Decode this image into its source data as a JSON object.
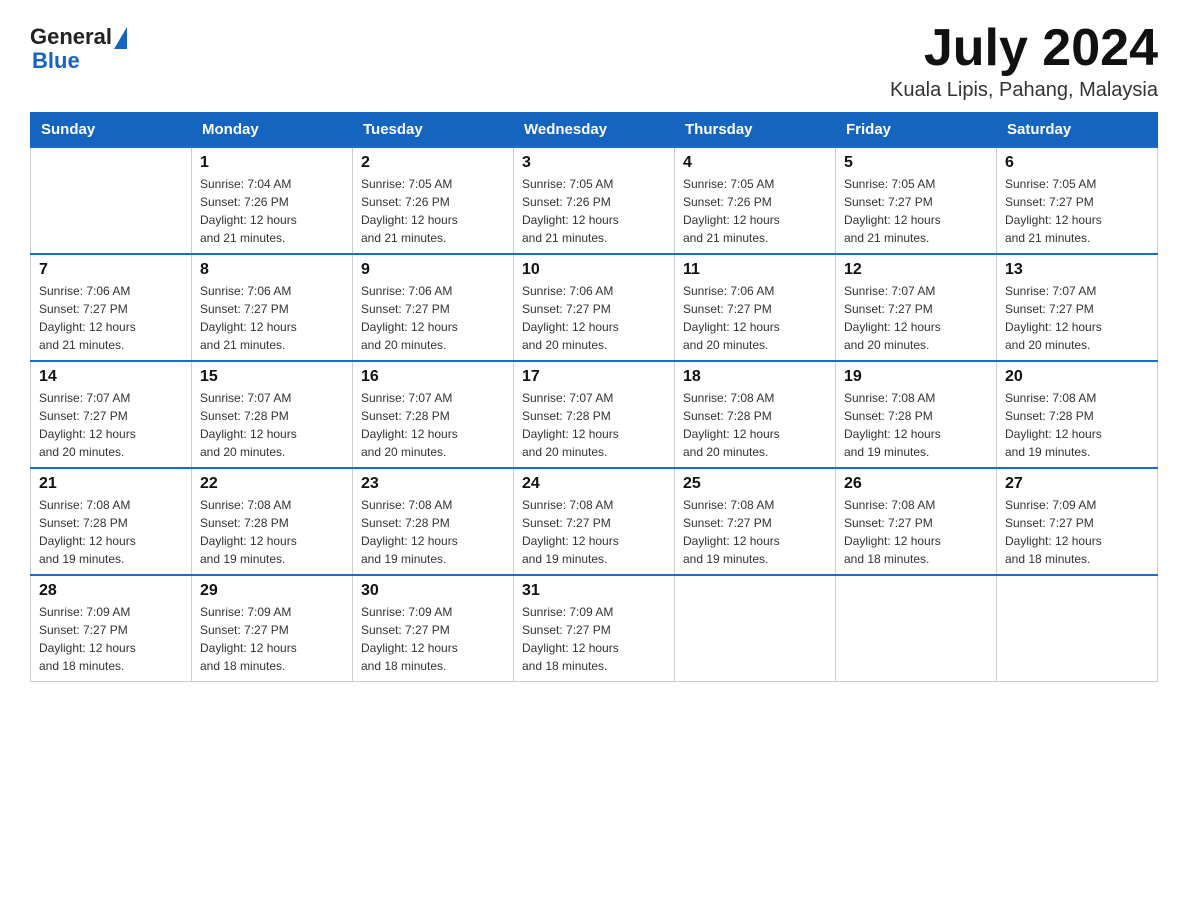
{
  "header": {
    "logo_text_general": "General",
    "logo_text_blue": "Blue",
    "title": "July 2024",
    "subtitle": "Kuala Lipis, Pahang, Malaysia"
  },
  "calendar": {
    "days_of_week": [
      "Sunday",
      "Monday",
      "Tuesday",
      "Wednesday",
      "Thursday",
      "Friday",
      "Saturday"
    ],
    "weeks": [
      [
        {
          "day": "",
          "info": ""
        },
        {
          "day": "1",
          "info": "Sunrise: 7:04 AM\nSunset: 7:26 PM\nDaylight: 12 hours\nand 21 minutes."
        },
        {
          "day": "2",
          "info": "Sunrise: 7:05 AM\nSunset: 7:26 PM\nDaylight: 12 hours\nand 21 minutes."
        },
        {
          "day": "3",
          "info": "Sunrise: 7:05 AM\nSunset: 7:26 PM\nDaylight: 12 hours\nand 21 minutes."
        },
        {
          "day": "4",
          "info": "Sunrise: 7:05 AM\nSunset: 7:26 PM\nDaylight: 12 hours\nand 21 minutes."
        },
        {
          "day": "5",
          "info": "Sunrise: 7:05 AM\nSunset: 7:27 PM\nDaylight: 12 hours\nand 21 minutes."
        },
        {
          "day": "6",
          "info": "Sunrise: 7:05 AM\nSunset: 7:27 PM\nDaylight: 12 hours\nand 21 minutes."
        }
      ],
      [
        {
          "day": "7",
          "info": "Sunrise: 7:06 AM\nSunset: 7:27 PM\nDaylight: 12 hours\nand 21 minutes."
        },
        {
          "day": "8",
          "info": "Sunrise: 7:06 AM\nSunset: 7:27 PM\nDaylight: 12 hours\nand 21 minutes."
        },
        {
          "day": "9",
          "info": "Sunrise: 7:06 AM\nSunset: 7:27 PM\nDaylight: 12 hours\nand 20 minutes."
        },
        {
          "day": "10",
          "info": "Sunrise: 7:06 AM\nSunset: 7:27 PM\nDaylight: 12 hours\nand 20 minutes."
        },
        {
          "day": "11",
          "info": "Sunrise: 7:06 AM\nSunset: 7:27 PM\nDaylight: 12 hours\nand 20 minutes."
        },
        {
          "day": "12",
          "info": "Sunrise: 7:07 AM\nSunset: 7:27 PM\nDaylight: 12 hours\nand 20 minutes."
        },
        {
          "day": "13",
          "info": "Sunrise: 7:07 AM\nSunset: 7:27 PM\nDaylight: 12 hours\nand 20 minutes."
        }
      ],
      [
        {
          "day": "14",
          "info": "Sunrise: 7:07 AM\nSunset: 7:27 PM\nDaylight: 12 hours\nand 20 minutes."
        },
        {
          "day": "15",
          "info": "Sunrise: 7:07 AM\nSunset: 7:28 PM\nDaylight: 12 hours\nand 20 minutes."
        },
        {
          "day": "16",
          "info": "Sunrise: 7:07 AM\nSunset: 7:28 PM\nDaylight: 12 hours\nand 20 minutes."
        },
        {
          "day": "17",
          "info": "Sunrise: 7:07 AM\nSunset: 7:28 PM\nDaylight: 12 hours\nand 20 minutes."
        },
        {
          "day": "18",
          "info": "Sunrise: 7:08 AM\nSunset: 7:28 PM\nDaylight: 12 hours\nand 20 minutes."
        },
        {
          "day": "19",
          "info": "Sunrise: 7:08 AM\nSunset: 7:28 PM\nDaylight: 12 hours\nand 19 minutes."
        },
        {
          "day": "20",
          "info": "Sunrise: 7:08 AM\nSunset: 7:28 PM\nDaylight: 12 hours\nand 19 minutes."
        }
      ],
      [
        {
          "day": "21",
          "info": "Sunrise: 7:08 AM\nSunset: 7:28 PM\nDaylight: 12 hours\nand 19 minutes."
        },
        {
          "day": "22",
          "info": "Sunrise: 7:08 AM\nSunset: 7:28 PM\nDaylight: 12 hours\nand 19 minutes."
        },
        {
          "day": "23",
          "info": "Sunrise: 7:08 AM\nSunset: 7:28 PM\nDaylight: 12 hours\nand 19 minutes."
        },
        {
          "day": "24",
          "info": "Sunrise: 7:08 AM\nSunset: 7:27 PM\nDaylight: 12 hours\nand 19 minutes."
        },
        {
          "day": "25",
          "info": "Sunrise: 7:08 AM\nSunset: 7:27 PM\nDaylight: 12 hours\nand 19 minutes."
        },
        {
          "day": "26",
          "info": "Sunrise: 7:08 AM\nSunset: 7:27 PM\nDaylight: 12 hours\nand 18 minutes."
        },
        {
          "day": "27",
          "info": "Sunrise: 7:09 AM\nSunset: 7:27 PM\nDaylight: 12 hours\nand 18 minutes."
        }
      ],
      [
        {
          "day": "28",
          "info": "Sunrise: 7:09 AM\nSunset: 7:27 PM\nDaylight: 12 hours\nand 18 minutes."
        },
        {
          "day": "29",
          "info": "Sunrise: 7:09 AM\nSunset: 7:27 PM\nDaylight: 12 hours\nand 18 minutes."
        },
        {
          "day": "30",
          "info": "Sunrise: 7:09 AM\nSunset: 7:27 PM\nDaylight: 12 hours\nand 18 minutes."
        },
        {
          "day": "31",
          "info": "Sunrise: 7:09 AM\nSunset: 7:27 PM\nDaylight: 12 hours\nand 18 minutes."
        },
        {
          "day": "",
          "info": ""
        },
        {
          "day": "",
          "info": ""
        },
        {
          "day": "",
          "info": ""
        }
      ]
    ]
  }
}
